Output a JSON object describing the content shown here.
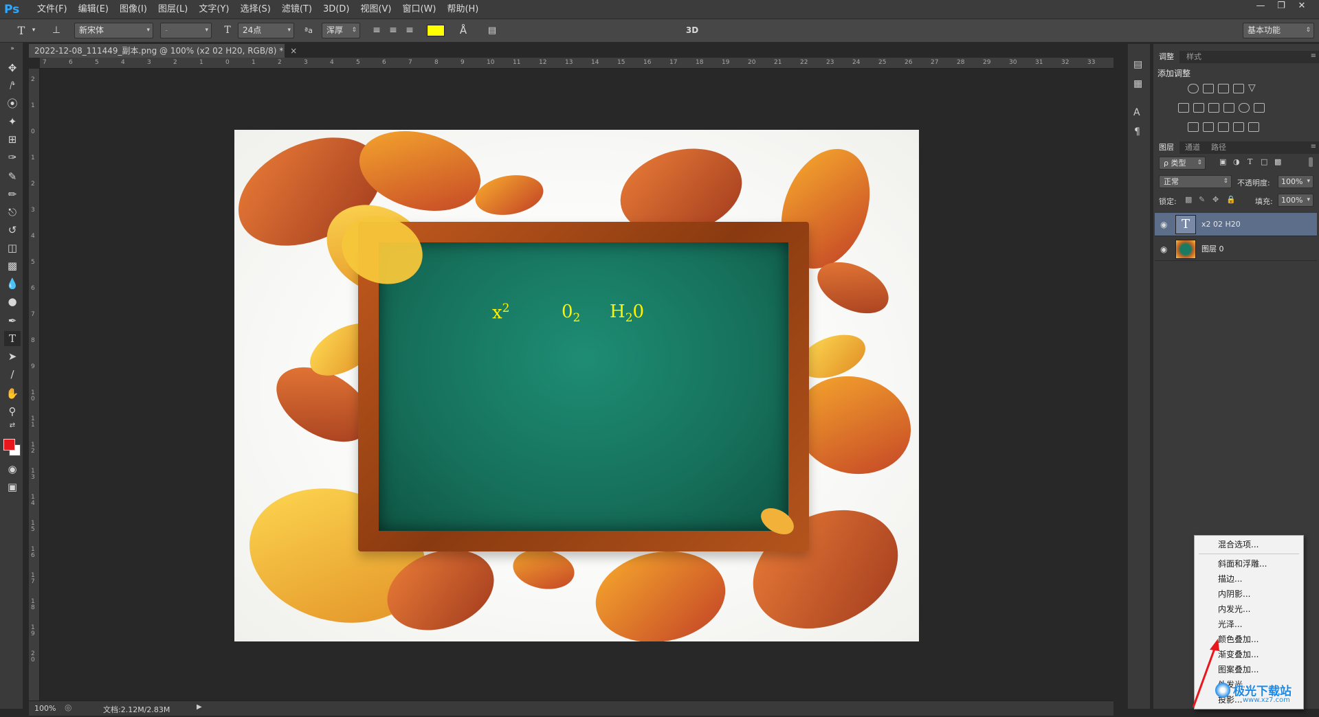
{
  "app": {
    "logo": "Ps"
  },
  "menu": [
    "文件(F)",
    "编辑(E)",
    "图像(I)",
    "图层(L)",
    "文字(Y)",
    "选择(S)",
    "滤镜(T)",
    "3D(D)",
    "视图(V)",
    "窗口(W)",
    "帮助(H)"
  ],
  "options": {
    "font_family": "新宋体",
    "font_style": "-",
    "font_size": "24点",
    "aa_label": "ªa",
    "antialias": "浑厚",
    "text_color": "#ffff00",
    "mode_3d": "3D",
    "workspace": "基本功能"
  },
  "doc": {
    "tab_title": "2022-12-08_111449_副本.png @ 100% (x2  02  H20, RGB/8) *",
    "close_glyph": "×",
    "zoom": "100%",
    "doc_size": "文档:2.12M/2.83M"
  },
  "canvas": {
    "formula_1_base": "x",
    "formula_1_sup": "2",
    "formula_2_base": "0",
    "formula_2_sub": "2",
    "formula_3_pre": "H",
    "formula_3_sub": "2",
    "formula_3_post": "0",
    "text_color": "#fff200",
    "board_color": "#16705b",
    "frame_color": "#b4541c"
  },
  "ruler": {
    "top_ticks": [
      "7",
      "6",
      "5",
      "4",
      "3",
      "2",
      "1",
      "0",
      "1",
      "2",
      "3",
      "4",
      "5",
      "6",
      "7",
      "8",
      "9",
      "10",
      "11",
      "12",
      "13",
      "14",
      "15",
      "16",
      "17",
      "18",
      "19",
      "20",
      "21",
      "22",
      "23",
      "24",
      "25",
      "26",
      "27",
      "28",
      "29",
      "30",
      "31",
      "32",
      "33"
    ],
    "left_ticks": [
      "2",
      "1",
      "0",
      "1",
      "2",
      "3",
      "4",
      "5",
      "6",
      "7",
      "8",
      "9",
      "1 0",
      "1 1",
      "1 2",
      "1 3",
      "1 4",
      "1 5",
      "1 6",
      "1 7",
      "1 8",
      "1 9",
      "2 0"
    ]
  },
  "adjustments": {
    "tabs": [
      "调整",
      "样式"
    ],
    "add_label": "添加调整"
  },
  "layers_panel": {
    "tabs": [
      "图层",
      "通道",
      "路径"
    ],
    "filter_label": "ρ 类型",
    "blend_mode": "正常",
    "opacity_label": "不透明度:",
    "opacity_value": "100%",
    "lock_label": "锁定:",
    "fill_label": "填充:",
    "fill_value": "100%",
    "text_thumb_glyph": "T",
    "layers": [
      {
        "name": "x2  02  H20",
        "type": "text",
        "selected": true
      },
      {
        "name": "图层 0",
        "type": "image",
        "selected": false
      }
    ]
  },
  "context_menu": {
    "items": [
      "混合选项...",
      "斜面和浮雕...",
      "描边...",
      "内阴影...",
      "内发光...",
      "光泽...",
      "颜色叠加...",
      "渐变叠加...",
      "图案叠加...",
      "外发光...",
      "投影..."
    ]
  },
  "watermark": {
    "text": "极光下载站",
    "url": "www.xz7.com"
  }
}
